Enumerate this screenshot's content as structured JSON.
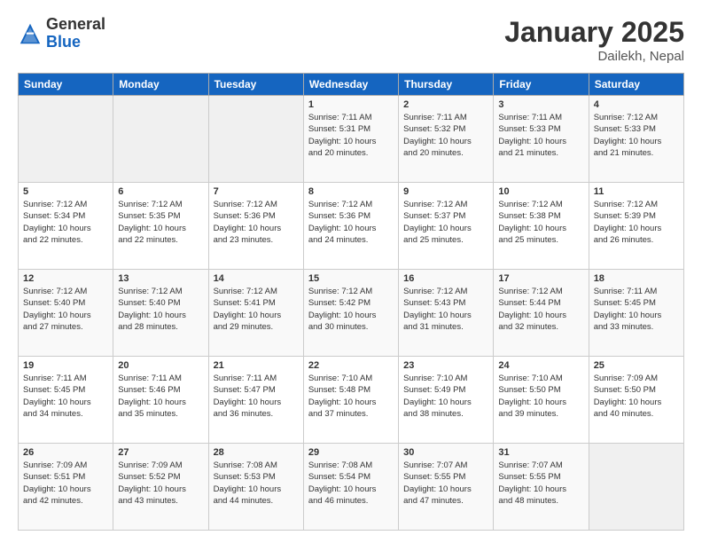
{
  "logo": {
    "general": "General",
    "blue": "Blue"
  },
  "header": {
    "month": "January 2025",
    "location": "Dailekh, Nepal"
  },
  "weekdays": [
    "Sunday",
    "Monday",
    "Tuesday",
    "Wednesday",
    "Thursday",
    "Friday",
    "Saturday"
  ],
  "rows": [
    [
      {
        "day": "",
        "content": ""
      },
      {
        "day": "",
        "content": ""
      },
      {
        "day": "",
        "content": ""
      },
      {
        "day": "1",
        "content": "Sunrise: 7:11 AM\nSunset: 5:31 PM\nDaylight: 10 hours\nand 20 minutes."
      },
      {
        "day": "2",
        "content": "Sunrise: 7:11 AM\nSunset: 5:32 PM\nDaylight: 10 hours\nand 20 minutes."
      },
      {
        "day": "3",
        "content": "Sunrise: 7:11 AM\nSunset: 5:33 PM\nDaylight: 10 hours\nand 21 minutes."
      },
      {
        "day": "4",
        "content": "Sunrise: 7:12 AM\nSunset: 5:33 PM\nDaylight: 10 hours\nand 21 minutes."
      }
    ],
    [
      {
        "day": "5",
        "content": "Sunrise: 7:12 AM\nSunset: 5:34 PM\nDaylight: 10 hours\nand 22 minutes."
      },
      {
        "day": "6",
        "content": "Sunrise: 7:12 AM\nSunset: 5:35 PM\nDaylight: 10 hours\nand 22 minutes."
      },
      {
        "day": "7",
        "content": "Sunrise: 7:12 AM\nSunset: 5:36 PM\nDaylight: 10 hours\nand 23 minutes."
      },
      {
        "day": "8",
        "content": "Sunrise: 7:12 AM\nSunset: 5:36 PM\nDaylight: 10 hours\nand 24 minutes."
      },
      {
        "day": "9",
        "content": "Sunrise: 7:12 AM\nSunset: 5:37 PM\nDaylight: 10 hours\nand 25 minutes."
      },
      {
        "day": "10",
        "content": "Sunrise: 7:12 AM\nSunset: 5:38 PM\nDaylight: 10 hours\nand 25 minutes."
      },
      {
        "day": "11",
        "content": "Sunrise: 7:12 AM\nSunset: 5:39 PM\nDaylight: 10 hours\nand 26 minutes."
      }
    ],
    [
      {
        "day": "12",
        "content": "Sunrise: 7:12 AM\nSunset: 5:40 PM\nDaylight: 10 hours\nand 27 minutes."
      },
      {
        "day": "13",
        "content": "Sunrise: 7:12 AM\nSunset: 5:40 PM\nDaylight: 10 hours\nand 28 minutes."
      },
      {
        "day": "14",
        "content": "Sunrise: 7:12 AM\nSunset: 5:41 PM\nDaylight: 10 hours\nand 29 minutes."
      },
      {
        "day": "15",
        "content": "Sunrise: 7:12 AM\nSunset: 5:42 PM\nDaylight: 10 hours\nand 30 minutes."
      },
      {
        "day": "16",
        "content": "Sunrise: 7:12 AM\nSunset: 5:43 PM\nDaylight: 10 hours\nand 31 minutes."
      },
      {
        "day": "17",
        "content": "Sunrise: 7:12 AM\nSunset: 5:44 PM\nDaylight: 10 hours\nand 32 minutes."
      },
      {
        "day": "18",
        "content": "Sunrise: 7:11 AM\nSunset: 5:45 PM\nDaylight: 10 hours\nand 33 minutes."
      }
    ],
    [
      {
        "day": "19",
        "content": "Sunrise: 7:11 AM\nSunset: 5:45 PM\nDaylight: 10 hours\nand 34 minutes."
      },
      {
        "day": "20",
        "content": "Sunrise: 7:11 AM\nSunset: 5:46 PM\nDaylight: 10 hours\nand 35 minutes."
      },
      {
        "day": "21",
        "content": "Sunrise: 7:11 AM\nSunset: 5:47 PM\nDaylight: 10 hours\nand 36 minutes."
      },
      {
        "day": "22",
        "content": "Sunrise: 7:10 AM\nSunset: 5:48 PM\nDaylight: 10 hours\nand 37 minutes."
      },
      {
        "day": "23",
        "content": "Sunrise: 7:10 AM\nSunset: 5:49 PM\nDaylight: 10 hours\nand 38 minutes."
      },
      {
        "day": "24",
        "content": "Sunrise: 7:10 AM\nSunset: 5:50 PM\nDaylight: 10 hours\nand 39 minutes."
      },
      {
        "day": "25",
        "content": "Sunrise: 7:09 AM\nSunset: 5:50 PM\nDaylight: 10 hours\nand 40 minutes."
      }
    ],
    [
      {
        "day": "26",
        "content": "Sunrise: 7:09 AM\nSunset: 5:51 PM\nDaylight: 10 hours\nand 42 minutes."
      },
      {
        "day": "27",
        "content": "Sunrise: 7:09 AM\nSunset: 5:52 PM\nDaylight: 10 hours\nand 43 minutes."
      },
      {
        "day": "28",
        "content": "Sunrise: 7:08 AM\nSunset: 5:53 PM\nDaylight: 10 hours\nand 44 minutes."
      },
      {
        "day": "29",
        "content": "Sunrise: 7:08 AM\nSunset: 5:54 PM\nDaylight: 10 hours\nand 46 minutes."
      },
      {
        "day": "30",
        "content": "Sunrise: 7:07 AM\nSunset: 5:55 PM\nDaylight: 10 hours\nand 47 minutes."
      },
      {
        "day": "31",
        "content": "Sunrise: 7:07 AM\nSunset: 5:55 PM\nDaylight: 10 hours\nand 48 minutes."
      },
      {
        "day": "",
        "content": ""
      }
    ]
  ]
}
